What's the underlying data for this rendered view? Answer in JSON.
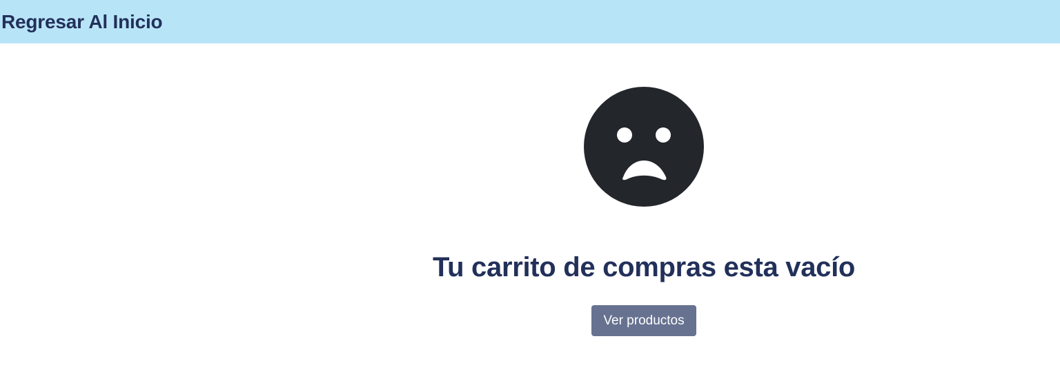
{
  "header": {
    "home_link": "Regresar Al Inicio"
  },
  "empty_cart": {
    "icon": "sad-face-icon",
    "message": "Tu carrito de compras esta vacío",
    "button_label": "Ver productos"
  },
  "colors": {
    "header_bg": "#b8e4f8",
    "title_text": "#22305a",
    "icon": "#23262b",
    "button_bg": "#677291",
    "button_text": "#ffffff"
  }
}
